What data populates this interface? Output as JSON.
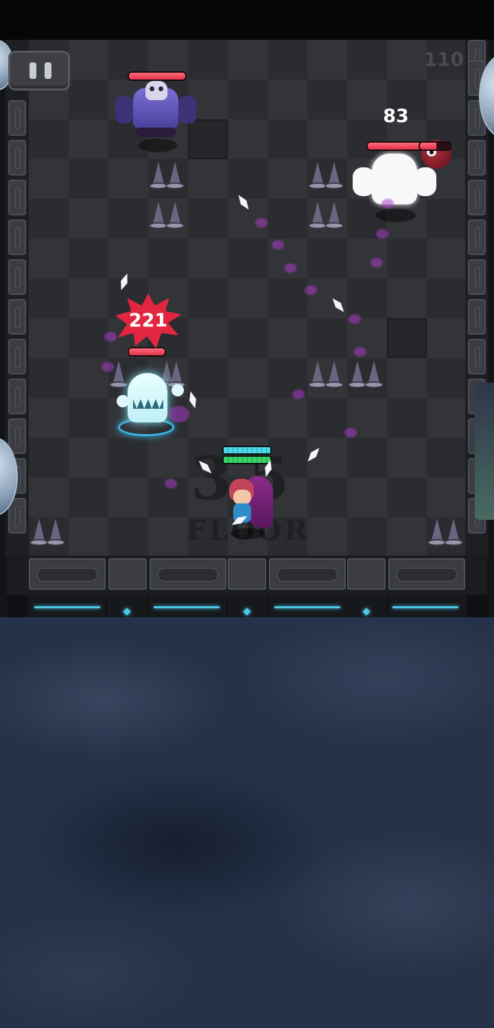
{
  "hud": {
    "pause_icon": "pause-icon",
    "level_counter": "110"
  },
  "floor_marker": {
    "number": "35",
    "label": "FLOOR"
  },
  "enemies": [
    {
      "name": "skull-robot",
      "hp_fraction": 1.0
    },
    {
      "name": "white-yeti",
      "hp_fraction": 1.0,
      "damage_popup": "83"
    },
    {
      "name": "red-eye-bat",
      "hp_fraction": 0.55
    },
    {
      "name": "ice-ghost",
      "hp_fraction": 1.0,
      "damage_popup": "221"
    }
  ],
  "player": {
    "shield_fraction": 1.0,
    "hp_fraction": 1.0
  },
  "colors": {
    "enemy_hp": "#e2334a",
    "player_shield": "#4cd8e8",
    "player_hp": "#3bd16a",
    "accent_rail": "#4cc8e8",
    "crit_burst": "#e3263f"
  }
}
